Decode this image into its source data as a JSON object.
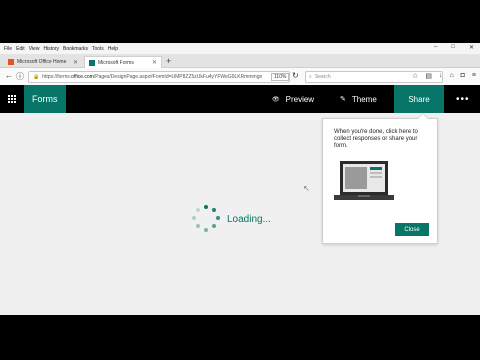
{
  "browser": {
    "menu": [
      "File",
      "Edit",
      "View",
      "History",
      "Bookmarks",
      "Tools",
      "Help"
    ],
    "window_controls": [
      "–",
      "□",
      "✕"
    ],
    "tabs": [
      {
        "label": "Microsoft Office Home",
        "active": false
      },
      {
        "label": "Microsoft Forms",
        "active": true
      }
    ],
    "url_prefix": "https://forms.",
    "url_domain": "office.com",
    "url_rest": "/Pages/DesignPage.aspx#FormId=UMP8ZZ5zUkFu4yYFWeG9LKRmmmgn",
    "zoom": "110%",
    "search_placeholder": "Search"
  },
  "appbar": {
    "brand": "Forms",
    "preview": "Preview",
    "theme": "Theme",
    "share": "Share",
    "more": "•••"
  },
  "main": {
    "loading_text": "Loading..."
  },
  "callout": {
    "text": "When you're done, click here to collect responses or share your form.",
    "close_label": "Close"
  },
  "colors": {
    "accent": "#077568",
    "appbar_bg": "#000000"
  }
}
